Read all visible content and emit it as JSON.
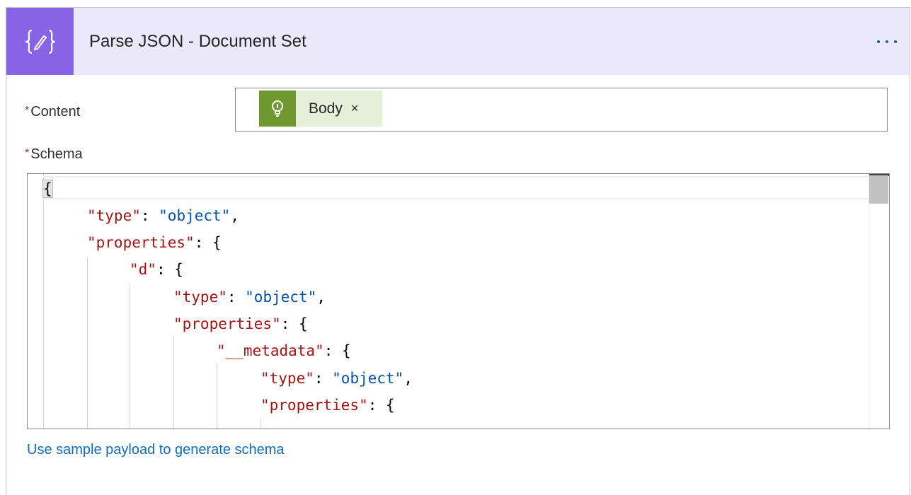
{
  "header": {
    "title": "Parse JSON - Document Set",
    "icon": "curly-braces-edit-icon",
    "accent": "#8764e6",
    "background": "#ebe8fc"
  },
  "fields": {
    "content": {
      "required_mark": "*",
      "label": "Content",
      "token": {
        "label": "Body",
        "close": "×",
        "icon": "lightbulb-icon",
        "color": "#6f982f"
      }
    },
    "schema": {
      "required_mark": "*",
      "label": "Schema"
    }
  },
  "editor": {
    "lines": [
      {
        "key": "",
        "val": "",
        "open": "{"
      },
      {
        "key": "\"type\"",
        "val": "\"object\"",
        "tail": ","
      },
      {
        "key": "\"properties\"",
        "val": "",
        "tail": "{"
      },
      {
        "key": "\"d\"",
        "val": "",
        "tail": "{"
      },
      {
        "key": "\"type\"",
        "val": "\"object\"",
        "tail": ","
      },
      {
        "key": "\"properties\"",
        "val": "",
        "tail": "{"
      },
      {
        "key": "\"__metadata\"",
        "val": "",
        "tail": "{"
      },
      {
        "key": "\"type\"",
        "val": "\"object\"",
        "tail": ","
      },
      {
        "key": "\"properties\"",
        "val": "",
        "tail": "{"
      }
    ]
  },
  "footer": {
    "link": "Use sample payload to generate schema"
  }
}
